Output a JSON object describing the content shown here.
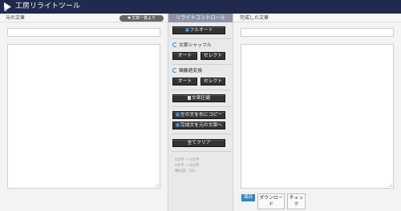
{
  "header": {
    "title": "工房リライトツール"
  },
  "left": {
    "title": "元の文章",
    "pill_label": "文章一覧より"
  },
  "center": {
    "title": "リライトコントロール",
    "full_auto_label": "フルオート",
    "shuffle": {
      "title": "文章シャッフル",
      "auto_label": "オート",
      "select_label": "セレクト"
    },
    "synonym": {
      "title": "類義語変換",
      "auto_label": "オート",
      "select_label": "セレクト"
    },
    "compress_label": "文章圧縮",
    "copy_right_label": "左の文を右にコピー",
    "to_original_label": "完成文を元の文章へ",
    "clear_label": "全てクリア",
    "stats": {
      "line1_a": "0文字",
      "line1_arrow": "→",
      "line1_b": "0文字",
      "line2_a": "0文字",
      "line2_arrow": "→",
      "line2_b": "0文字",
      "line3": "類似度：0%"
    }
  },
  "right": {
    "title": "完成した文章",
    "save_label": "保存",
    "download_label": "ダウンロード",
    "check_label": "チェック"
  },
  "colors": {
    "header_bg": "#1f2a4d",
    "accent_blue": "#2f86c6",
    "button_dark": "#333333"
  }
}
